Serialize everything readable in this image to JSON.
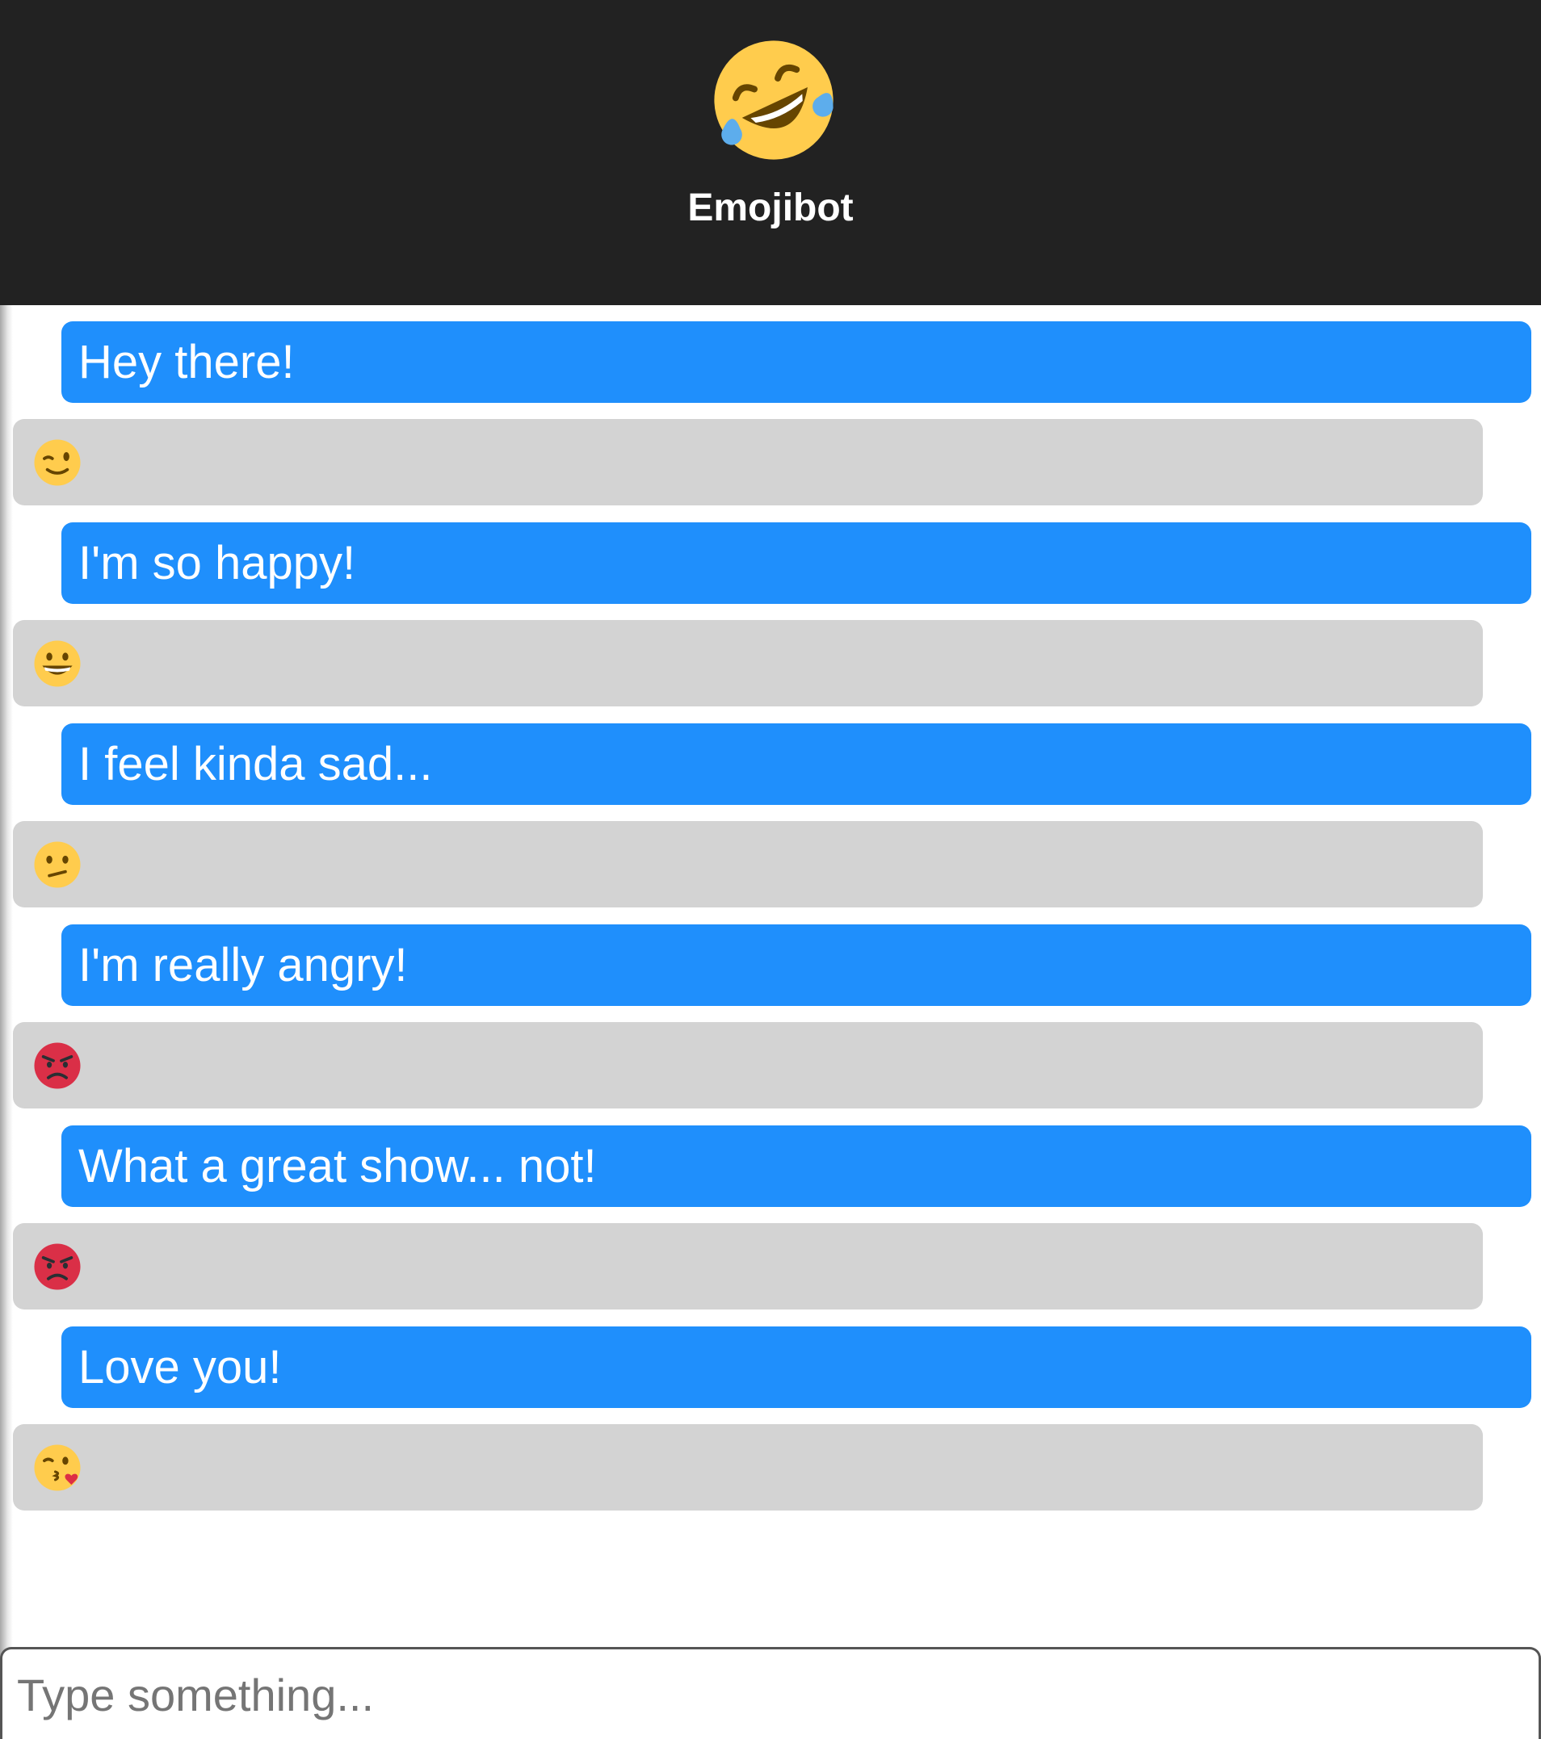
{
  "header": {
    "title": "Emojibot",
    "avatar_icon": "rolling-on-floor-laughing-emoji"
  },
  "messages": [
    {
      "from": "user",
      "text": "Hey there!"
    },
    {
      "from": "bot",
      "emoji": "winking-face-emoji"
    },
    {
      "from": "user",
      "text": "I'm so happy!"
    },
    {
      "from": "bot",
      "emoji": "grinning-squinting-face-emoji"
    },
    {
      "from": "user",
      "text": "I feel kinda sad..."
    },
    {
      "from": "bot",
      "emoji": "confused-face-emoji"
    },
    {
      "from": "user",
      "text": "I'm really angry!"
    },
    {
      "from": "bot",
      "emoji": "angry-face-emoji"
    },
    {
      "from": "user",
      "text": "What a great show... not!"
    },
    {
      "from": "bot",
      "emoji": "angry-face-emoji"
    },
    {
      "from": "user",
      "text": "Love you!"
    },
    {
      "from": "bot",
      "emoji": "face-blowing-kiss-emoji"
    }
  ],
  "composer": {
    "placeholder": "Type something...",
    "value": ""
  },
  "colors": {
    "header_bg": "#222222",
    "user_bubble": "#1f8ffc",
    "bot_bubble": "#d3d3d3",
    "emoji_yellow": "#ffcc4d",
    "emoji_red": "#da2f47"
  }
}
